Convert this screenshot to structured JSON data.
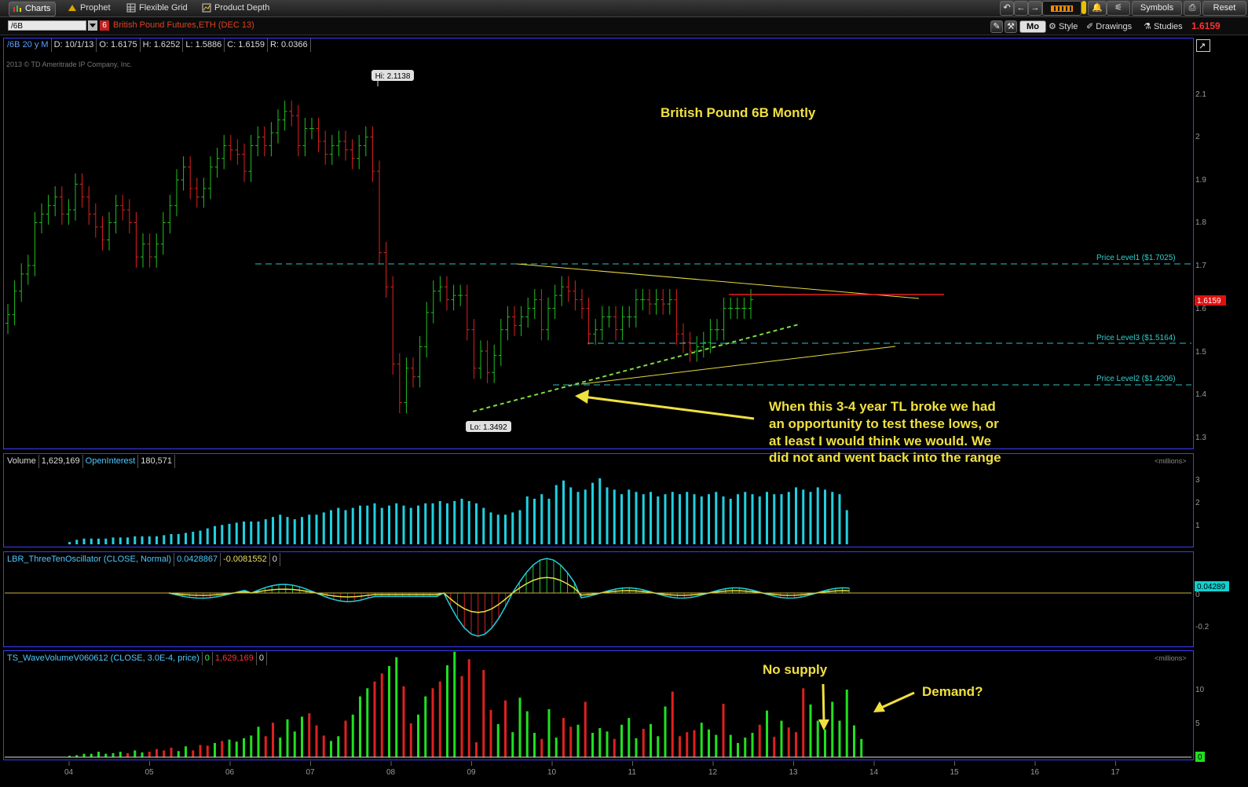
{
  "toolbar": {
    "tabs": [
      {
        "label": "Charts",
        "active": true,
        "icon": "charts-icon"
      },
      {
        "label": "Prophet",
        "active": false,
        "icon": "prophet-icon"
      },
      {
        "label": "Flexible Grid",
        "active": false,
        "icon": "grid-icon"
      },
      {
        "label": "Product Depth",
        "active": false,
        "icon": "product-depth-icon"
      }
    ],
    "symbols_label": "Symbols",
    "reset_label": "Reset"
  },
  "symbolbar": {
    "symbol": "/6B",
    "link_number": "6",
    "description": "British Pound Futures,ETH (DEC 13)",
    "aggregation": "Mo",
    "style_label": "Style",
    "drawings_label": "Drawings",
    "studies_label": "Studies",
    "last_price": "1.6159"
  },
  "price_panel": {
    "header": [
      "/6B 20 y M",
      "D: 10/1/13",
      "O: 1.6175",
      "H: 1.6252",
      "L: 1.5886",
      "C: 1.6159",
      "R: 0.0366"
    ],
    "copyright": "2013 © TD Ameritrade IP Company, Inc.",
    "hi_label": "Hi: 2.1138",
    "lo_label": "Lo: 1.3492",
    "title": "British Pound 6B Montly",
    "price_level1": "Price Level1 ($1.7025)",
    "price_level2": "Price Level2 ($1.4206)",
    "price_level3": "Price Level3 ($1.5164)",
    "last_tag": "1.6159",
    "axis_ticks": [
      "2.1",
      "2",
      "1.9",
      "1.8",
      "1.7",
      "1.6",
      "1.5",
      "1.4",
      "1.3"
    ],
    "annotation": [
      "When this 3-4 year TL broke we had",
      "an opportunity to test these lows, or",
      "at least I would think we would.  We",
      "did not and went back into the range"
    ]
  },
  "volume_panel": {
    "header": [
      "Volume",
      "1,629,169",
      "OpenInterest",
      "180,571"
    ],
    "units": "<millions>",
    "axis_ticks": [
      "3",
      "2",
      "1"
    ]
  },
  "osc_panel": {
    "header": [
      "LBR_ThreeTenOscillator (CLOSE, Normal)",
      "0.0428867",
      "-0.0081552",
      "0"
    ],
    "axis_ticks": [
      "0",
      "-0.2"
    ],
    "last_tag": "0.04289"
  },
  "wave_panel": {
    "header": [
      "TS_WaveVolumeV060612 (CLOSE, 3.0E-4, price)",
      "0",
      "1,629,169",
      "0"
    ],
    "units": "<millions>",
    "axis_ticks": [
      "10",
      "5"
    ],
    "zero_tag": "0",
    "annotation_no_supply": "No supply",
    "annotation_demand": "Demand?"
  },
  "x_axis": [
    "04",
    "05",
    "06",
    "07",
    "08",
    "09",
    "10",
    "11",
    "12",
    "13",
    "14",
    "15",
    "16",
    "17"
  ],
  "chart_data": {
    "type": "bar",
    "title": "British Pound 6B Montly",
    "ylim": [
      1.3,
      2.15
    ],
    "price_levels": [
      1.7025,
      1.5164,
      1.4206
    ],
    "x_years": [
      "04",
      "05",
      "06",
      "07",
      "08",
      "09",
      "10",
      "11",
      "12",
      "13",
      "14",
      "15",
      "16",
      "17"
    ],
    "close": [
      1.585,
      1.64,
      1.68,
      1.7,
      1.8,
      1.82,
      1.84,
      1.86,
      1.82,
      1.83,
      1.89,
      1.86,
      1.82,
      1.79,
      1.76,
      1.8,
      1.84,
      1.83,
      1.8,
      1.72,
      1.75,
      1.72,
      1.75,
      1.8,
      1.84,
      1.9,
      1.93,
      1.88,
      1.86,
      1.88,
      1.93,
      1.95,
      1.98,
      1.97,
      1.96,
      1.92,
      1.98,
      2.0,
      1.98,
      2.01,
      2.04,
      2.06,
      2.05,
      1.98,
      2.02,
      2.02,
      1.99,
      1.96,
      1.98,
      1.99,
      1.97,
      1.95,
      1.98,
      2.0,
      1.92,
      1.73,
      1.65,
      1.47,
      1.38,
      1.46,
      1.44,
      1.51,
      1.59,
      1.64,
      1.65,
      1.62,
      1.63,
      1.63,
      1.55,
      1.46,
      1.5,
      1.45,
      1.49,
      1.55,
      1.58,
      1.56,
      1.58,
      1.6,
      1.62,
      1.55,
      1.6,
      1.63,
      1.65,
      1.64,
      1.62,
      1.6,
      1.54,
      1.55,
      1.58,
      1.58,
      1.55,
      1.58,
      1.58,
      1.62,
      1.62,
      1.61,
      1.62,
      1.61,
      1.62,
      1.54,
      1.52,
      1.5,
      1.51,
      1.52,
      1.55,
      1.55,
      1.6,
      1.6,
      1.6,
      1.6,
      1.62
    ],
    "volume_millions": [
      0.1,
      0.2,
      0.25,
      0.25,
      0.25,
      0.25,
      0.3,
      0.3,
      0.3,
      0.35,
      0.35,
      0.35,
      0.35,
      0.4,
      0.45,
      0.45,
      0.5,
      0.55,
      0.6,
      0.7,
      0.8,
      0.85,
      0.9,
      0.95,
      1.0,
      1.0,
      1.0,
      1.1,
      1.2,
      1.3,
      1.2,
      1.1,
      1.2,
      1.3,
      1.3,
      1.4,
      1.5,
      1.6,
      1.5,
      1.6,
      1.7,
      1.7,
      1.8,
      1.6,
      1.7,
      1.8,
      1.7,
      1.6,
      1.7,
      1.8,
      1.8,
      1.9,
      1.8,
      1.9,
      2.0,
      1.9,
      1.8,
      1.6,
      1.4,
      1.3,
      1.3,
      1.4,
      1.5,
      2.1,
      2.0,
      2.2,
      2.0,
      2.6,
      2.8,
      2.5,
      2.3,
      2.4,
      2.7,
      2.9,
      2.5,
      2.4,
      2.2,
      2.4,
      2.3,
      2.2,
      2.3,
      2.1,
      2.2,
      2.3,
      2.2,
      2.3,
      2.2,
      2.1,
      2.2,
      2.3,
      2.1,
      2.0,
      2.2,
      2.3,
      2.2,
      2.1,
      2.3,
      2.2,
      2.2,
      2.3,
      2.5,
      2.4,
      2.3,
      2.5,
      2.4,
      2.3,
      2.2,
      1.5
    ],
    "wave_volume": [
      0.2,
      0.3,
      0.5,
      0.5,
      0.8,
      0.5,
      0.6,
      0.8,
      0.6,
      1,
      0.7,
      0.8,
      1.2,
      1,
      1.4,
      0.9,
      1.6,
      1,
      1.8,
      1.7,
      2.1,
      2.4,
      2.6,
      2.3,
      2.8,
      3.2,
      4.5,
      3.1,
      5.1,
      2.9,
      5.6,
      3.8,
      6,
      6.5,
      4.7,
      3.2,
      2.4,
      3.1,
      5.4,
      6.3,
      9,
      10.2,
      11.2,
      12.4,
      13.5,
      14.8,
      10.5,
      5,
      6.3,
      9,
      10.2,
      11.2,
      13.6,
      15.6,
      12,
      14.5,
      2.2,
      12.9,
      7,
      4.9,
      8.4,
      3.7,
      8.8,
      6.8,
      3.6,
      2.7,
      7.1,
      2.9,
      5.8,
      4.5,
      4.8,
      8.2,
      3.6,
      4.3,
      3.8,
      2.7,
      4.8,
      5.8,
      2.8,
      4.2,
      4.9,
      3.1,
      7.5,
      9.7,
      3.1,
      3.7,
      4,
      5.1,
      4.1,
      3.3,
      7.9,
      3.3,
      2.1,
      2.9,
      3.6,
      4.8,
      6.9,
      3,
      5.4,
      4.4,
      3.7,
      10.2,
      7.8,
      5.4,
      4.1,
      8.2,
      5.4,
      10,
      4.7,
      2.7
    ]
  }
}
